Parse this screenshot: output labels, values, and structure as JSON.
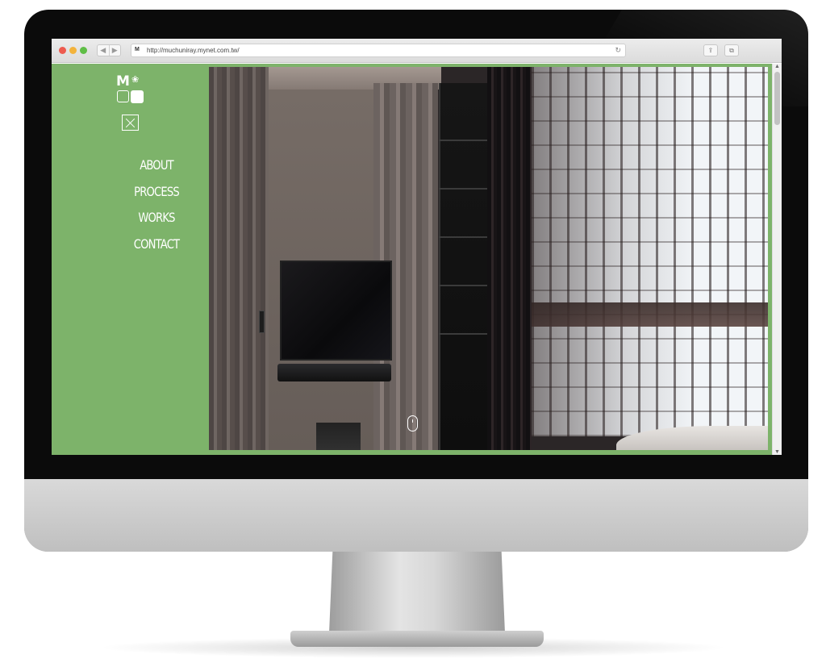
{
  "browser": {
    "url": "http://muchuniray.mynet.com.tw/",
    "favicon_text": "M",
    "nav_back": "◀",
    "nav_forward": "▶",
    "reload_icon": "↻",
    "share_icon": "⇪",
    "tabs_icon": "⧉"
  },
  "site": {
    "logo_letter": "M",
    "logo_plant": "❀",
    "menu": [
      {
        "label": "ABOUT"
      },
      {
        "label": "PROCESS"
      },
      {
        "label": "WORKS"
      },
      {
        "label": "CONTACT"
      }
    ],
    "accent_color": "#7db36a",
    "hero_image": "interior-bedroom-photo"
  },
  "scrollbar": {
    "up_icon": "▲",
    "down_icon": "▼"
  },
  "corner_button": "+"
}
